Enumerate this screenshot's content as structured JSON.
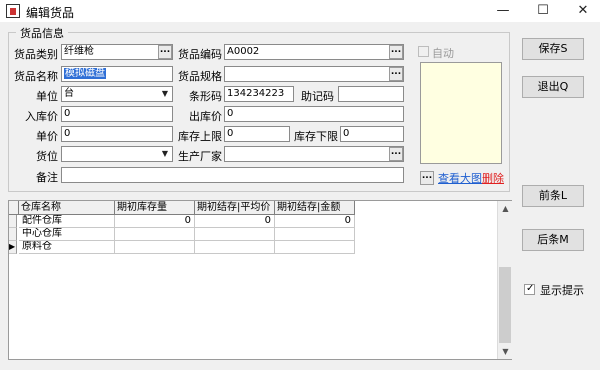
{
  "window": {
    "title": "编辑货品",
    "controls": [
      "—",
      "☐",
      "✕"
    ]
  },
  "form": {
    "group_title": "货品信息",
    "category": {
      "label": "货品类别",
      "value": "纤维枪"
    },
    "code": {
      "label": "货品编码",
      "value": "A0002"
    },
    "name": {
      "label": "货品名称",
      "value": "模拟磁盘"
    },
    "spec": {
      "label": "货品规格",
      "value": ""
    },
    "unit": {
      "label": "单位",
      "value": "台"
    },
    "barcode": {
      "label": "条形码",
      "value": "134234223"
    },
    "mnemonic": {
      "label": "助记码",
      "value": ""
    },
    "in_price": {
      "label": "入库价",
      "value": "0"
    },
    "out_price": {
      "label": "出库价",
      "value": "0"
    },
    "price": {
      "label": "单价",
      "value": "0"
    },
    "stock_max": {
      "label": "库存上限",
      "value": "0"
    },
    "stock_min": {
      "label": "库存下限",
      "value": "0"
    },
    "location": {
      "label": "货位",
      "value": ""
    },
    "manufacturer": {
      "label": "生产厂家",
      "value": ""
    },
    "remark": {
      "label": "备注",
      "value": ""
    },
    "auto_label": "自动",
    "view_image_link": "查看大图",
    "delete_link": "删除",
    "ellipsis": "..."
  },
  "buttons": {
    "save": "保存S",
    "exit": "退出Q",
    "prev": "前条L",
    "next": "后条M",
    "show_tips": "显示提示"
  },
  "grid": {
    "columns": [
      "仓库名称",
      "期初库存量",
      "期初结存|平均价",
      "期初结存|金额"
    ],
    "rows": [
      [
        "配件仓库",
        "0",
        "0",
        "0"
      ],
      [
        "中心仓库",
        "",
        "",
        ""
      ],
      [
        "原料仓",
        "",
        "",
        ""
      ]
    ]
  }
}
